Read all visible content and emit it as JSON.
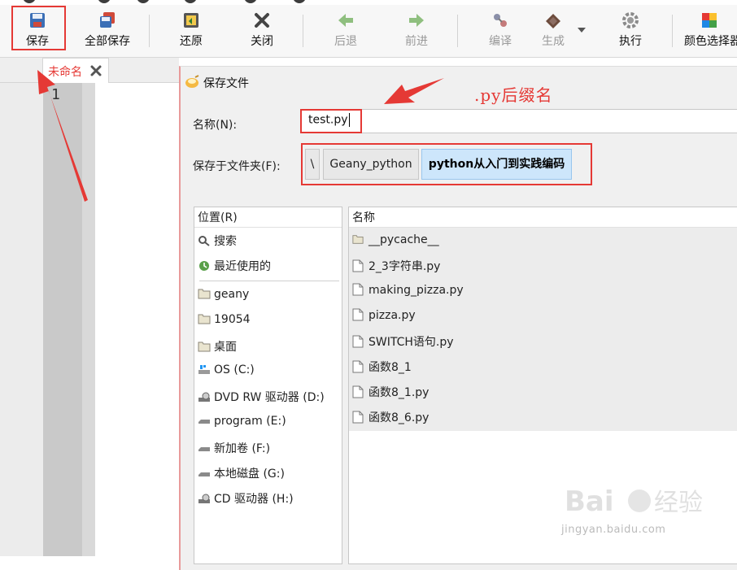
{
  "toolbar": {
    "save_label": "保存",
    "save_all_label": "全部保存",
    "revert_label": "还原",
    "close_label": "关闭",
    "back_label": "后退",
    "forward_label": "前进",
    "compile_label": "编译",
    "build_label": "生成",
    "execute_label": "执行",
    "color_picker_label": "颜色选择器"
  },
  "editor": {
    "tab_label": "未命名",
    "line_number": "1"
  },
  "dialog": {
    "title": "保存文件",
    "name_label": "名称(N):",
    "name_value": "test.py",
    "folder_label": "保存于文件夹(F):",
    "path_segments": [
      "\\",
      "Geany_python",
      "python从入门到实践编码"
    ],
    "places_header": "位置(R)",
    "places": [
      {
        "label": "搜索",
        "icon": "search-icon"
      },
      {
        "label": "最近使用的",
        "icon": "recent-icon"
      },
      {
        "label": "geany",
        "icon": "folder-icon"
      },
      {
        "label": "19054",
        "icon": "folder-icon"
      },
      {
        "label": "桌面",
        "icon": "folder-icon"
      },
      {
        "label": "OS (C:)",
        "icon": "windows-drive-icon"
      },
      {
        "label": "DVD RW 驱动器 (D:)",
        "icon": "optical-drive-icon"
      },
      {
        "label": "program (E:)",
        "icon": "drive-icon"
      },
      {
        "label": "新加卷 (F:)",
        "icon": "drive-icon"
      },
      {
        "label": "本地磁盘 (G:)",
        "icon": "drive-icon"
      },
      {
        "label": "CD 驱动器 (H:)",
        "icon": "optical-drive-icon"
      }
    ],
    "files_header": "名称",
    "files": [
      {
        "name": "__pycache__",
        "icon": "folder-icon"
      },
      {
        "name": "2_3字符串.py",
        "icon": "file-icon"
      },
      {
        "name": "making_pizza.py",
        "icon": "file-icon"
      },
      {
        "name": "pizza.py",
        "icon": "file-icon"
      },
      {
        "name": "SWITCH语句.py",
        "icon": "file-icon"
      },
      {
        "name": "函数8_1",
        "icon": "file-icon"
      },
      {
        "name": "函数8_1.py",
        "icon": "file-icon"
      },
      {
        "name": "函数8_6.py",
        "icon": "file-icon"
      }
    ]
  },
  "annotation": {
    "text": ".py后缀名",
    "color": "#e53935"
  },
  "watermark": {
    "brand": "Baidu经验",
    "url": "jingyan.baidu.com"
  }
}
